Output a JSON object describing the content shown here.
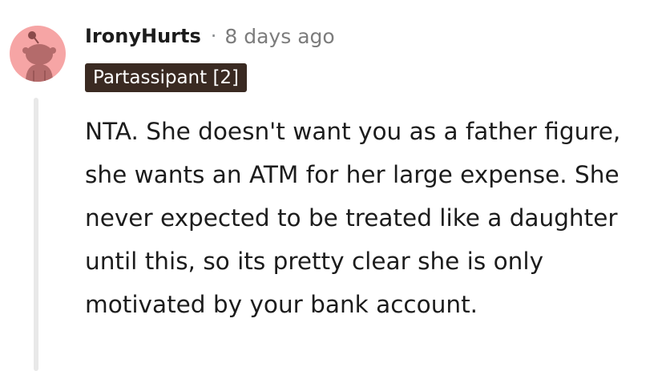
{
  "comment": {
    "username": "IronyHurts",
    "separator": "·",
    "timestamp": "8 days ago",
    "flair": "Partassipant [2]",
    "body": "NTA. She doesn't want you as a father figure, she wants an ATM for her large expense. She never expected to be treated like a daughter until this, so its pretty clear she is only motivated by your bank account."
  },
  "colors": {
    "avatar_bg": "#f6a5a5",
    "avatar_figure": "#8a4a4a",
    "flair_bg": "#3a2a22",
    "meta_gray": "#7c7c7c",
    "thread_line": "#e8e8e8"
  },
  "icons": {
    "avatar": "snoo-avatar-icon"
  }
}
